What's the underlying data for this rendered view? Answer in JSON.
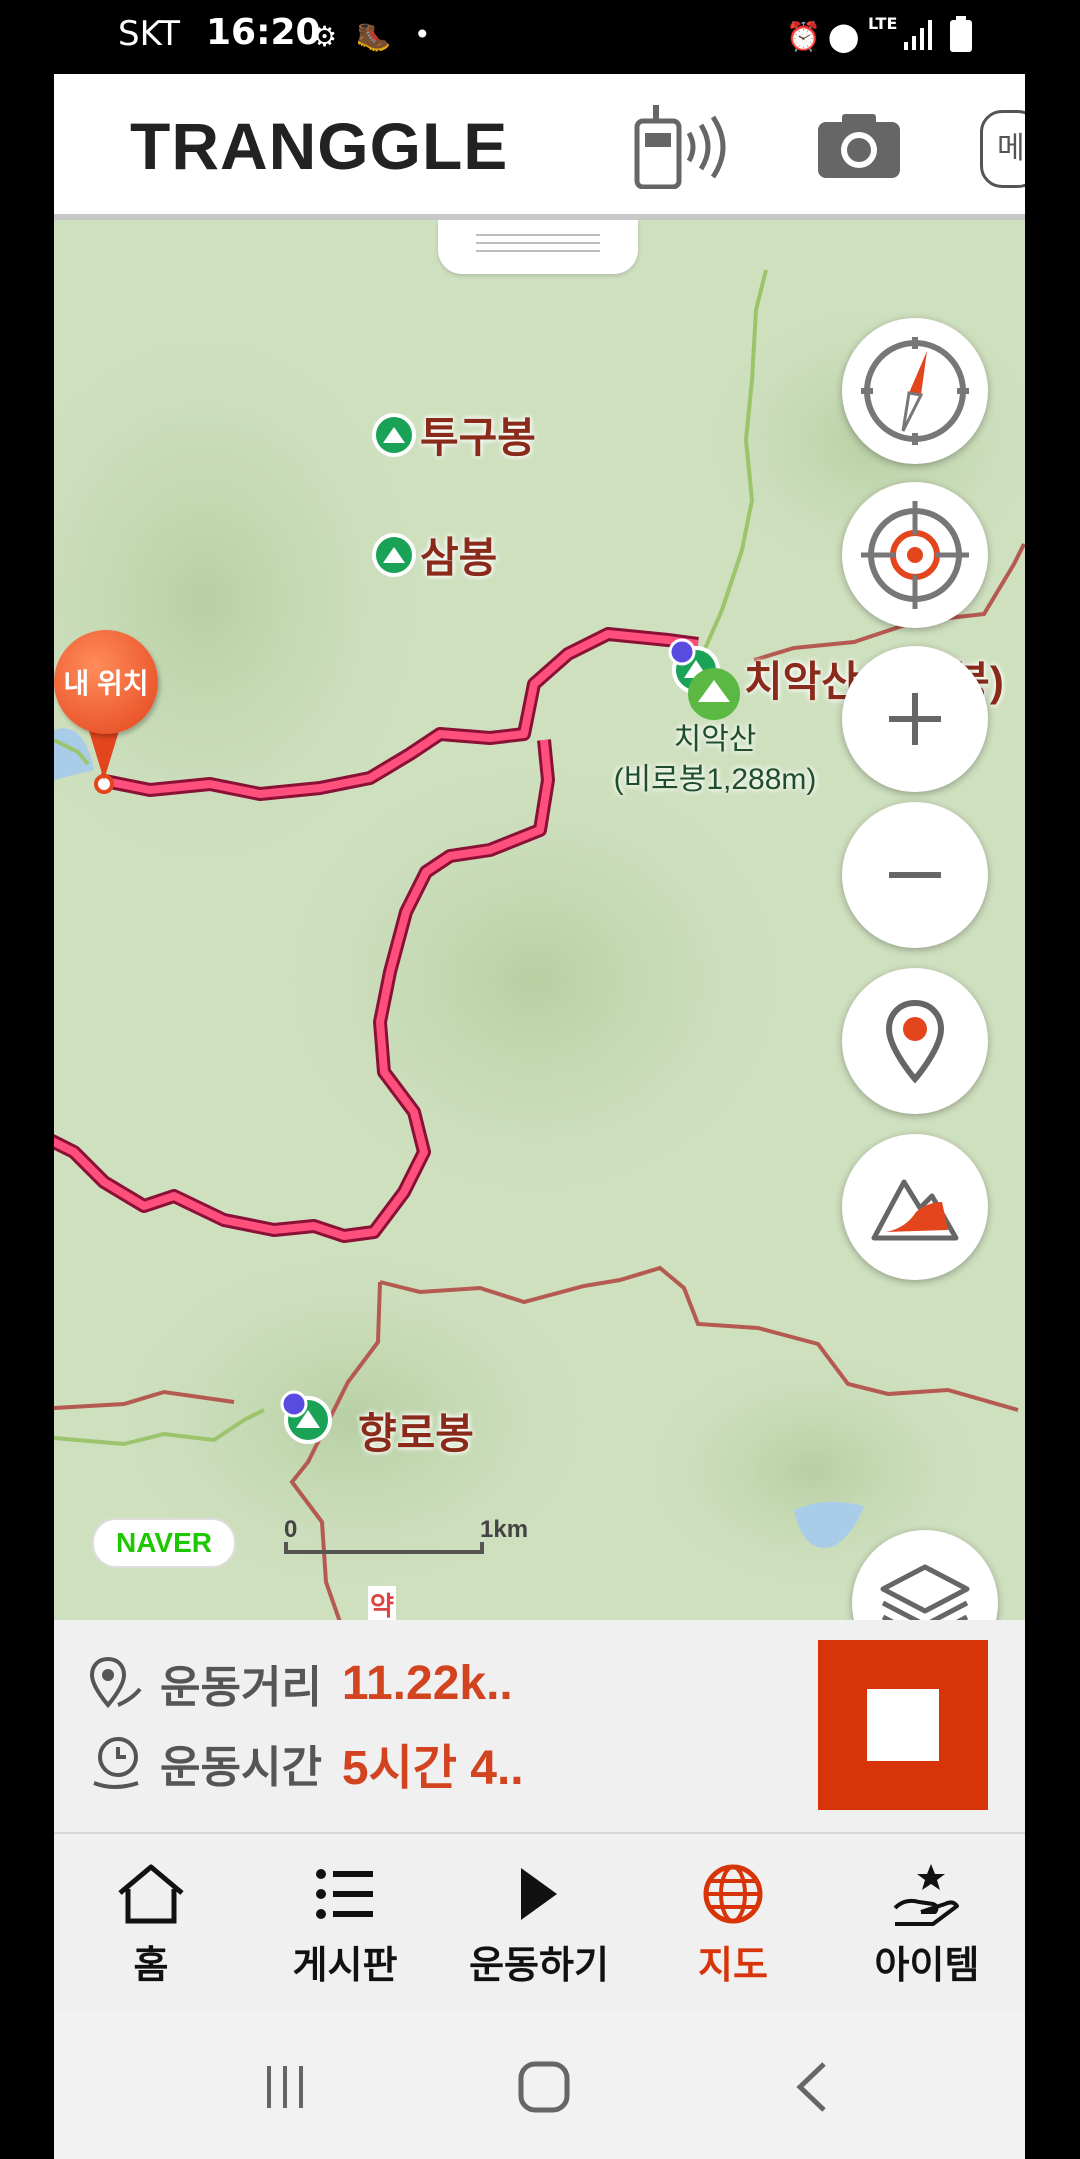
{
  "status_bar": {
    "carrier": "SKT",
    "time": "16:20",
    "network": "LTE"
  },
  "header": {
    "logo": "TRANGGLE",
    "radio_icon": "walkie-talkie-icon",
    "camera_icon": "camera-icon",
    "menu_label": "메"
  },
  "map": {
    "places": [
      {
        "name": "투구봉"
      },
      {
        "name": "삼봉"
      },
      {
        "name": "치악산(비로봉)"
      },
      {
        "name": "향로봉"
      }
    ],
    "peak_label_line1": "치악산",
    "peak_label_line2": "(비로봉1,288m)",
    "trail_marker": "약",
    "my_location": "내 위치",
    "naver": "NAVER",
    "scale_start": "0",
    "scale_end": "1km"
  },
  "map_controls": [
    "compass-icon",
    "locate-target-icon",
    "zoom-in-icon",
    "zoom-out-icon",
    "marker-icon",
    "elevation-profile-icon",
    "layers-icon"
  ],
  "stats": {
    "distance_label": "운동거리",
    "distance_value": "11.22k..",
    "time_label": "운동시간",
    "time_value": "5시간 4.."
  },
  "tabs": [
    {
      "label": "홈",
      "icon": "home-icon"
    },
    {
      "label": "게시판",
      "icon": "list-icon"
    },
    {
      "label": "운동하기",
      "icon": "play-icon"
    },
    {
      "label": "지도",
      "icon": "globe-icon",
      "active": true
    },
    {
      "label": "아이템",
      "icon": "hand-star-icon"
    }
  ],
  "colors": {
    "accent": "#d8340a",
    "route": "#e8305a",
    "map_bg": "#cfe0bf"
  }
}
